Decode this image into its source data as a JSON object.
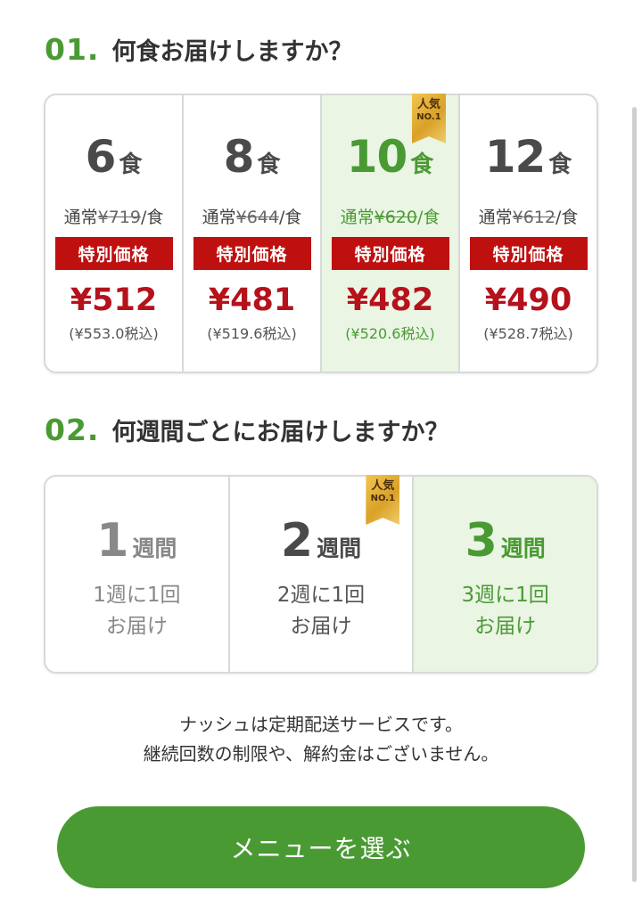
{
  "step1": {
    "number": "01.",
    "title": "何食お届けしますか？",
    "options": [
      {
        "count": "6",
        "unit": "食",
        "regular_label": "通常",
        "regular_price": "¥719",
        "per": "/食",
        "special_label": "特別価格",
        "price": "¥512",
        "tax": "(¥553.0税込)"
      },
      {
        "count": "8",
        "unit": "食",
        "regular_label": "通常",
        "regular_price": "¥644",
        "per": "/食",
        "special_label": "特別価格",
        "price": "¥481",
        "tax": "(¥519.6税込)"
      },
      {
        "count": "10",
        "unit": "食",
        "regular_label": "通常",
        "regular_price": "¥620",
        "per": "/食",
        "special_label": "特別価格",
        "price": "¥482",
        "tax": "(¥520.6税込)",
        "selected": true,
        "badge": {
          "line1": "人気",
          "line2": "NO.1"
        }
      },
      {
        "count": "12",
        "unit": "食",
        "regular_label": "通常",
        "regular_price": "¥612",
        "per": "/食",
        "special_label": "特別価格",
        "price": "¥490",
        "tax": "(¥528.7税込)"
      }
    ]
  },
  "step2": {
    "number": "02.",
    "title": "何週間ごとにお届けしますか？",
    "options": [
      {
        "count": "1",
        "unit": "週間",
        "desc1": "1週に1回",
        "desc2": "お届け"
      },
      {
        "count": "2",
        "unit": "週間",
        "desc1": "2週に1回",
        "desc2": "お届け",
        "badge": {
          "line1": "人気",
          "line2": "NO.1"
        }
      },
      {
        "count": "3",
        "unit": "週間",
        "desc1": "3週に1回",
        "desc2": "お届け",
        "selected": true
      }
    ]
  },
  "note": {
    "line1": "ナッシュは定期配送サービスです。",
    "line2": "継続回数の制限や、解約金はございません。"
  },
  "cta": {
    "label": "メニューを選ぶ"
  },
  "colors": {
    "accent": "#4a9a34",
    "price_red": "#b5121b",
    "special_bg": "#bf1010",
    "selected_bg": "#eaf5e4",
    "badge_gold": "#d9a127"
  }
}
